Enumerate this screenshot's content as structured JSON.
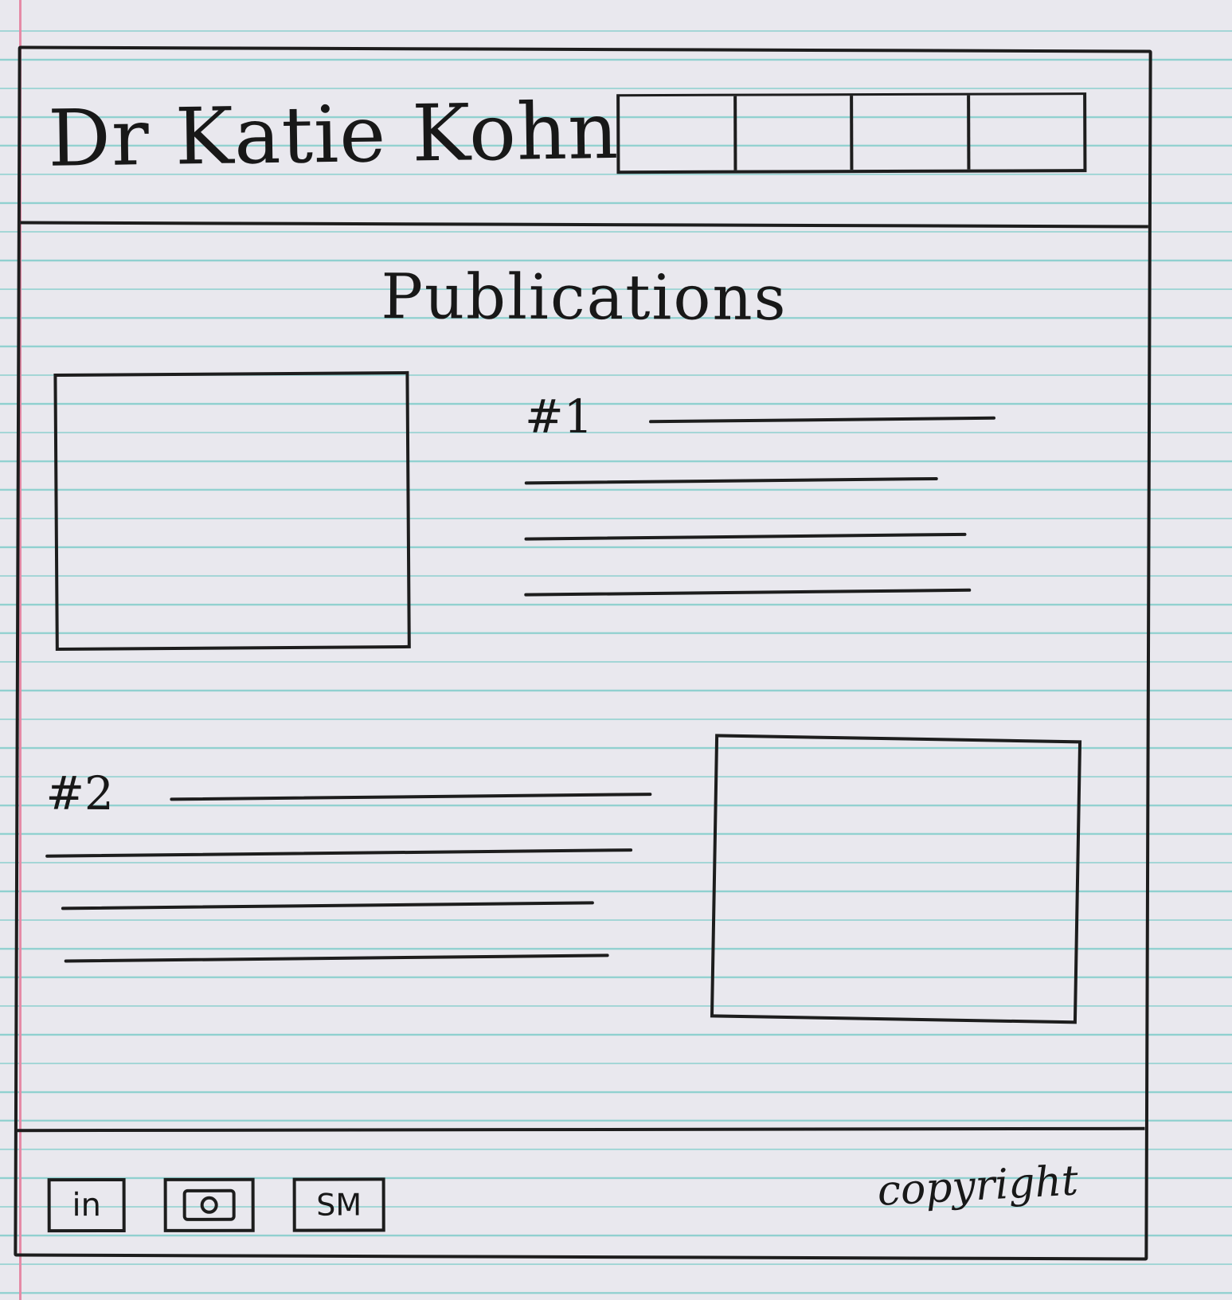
{
  "header": {
    "title": "Dr Katie Kohn",
    "nav_items": [
      {
        "label": ""
      },
      {
        "label": ""
      },
      {
        "label": ""
      },
      {
        "label": ""
      }
    ]
  },
  "main": {
    "title": "Publications",
    "publications": [
      {
        "number": "#1"
      },
      {
        "number": "#2"
      }
    ]
  },
  "footer": {
    "social": [
      {
        "label": "in",
        "icon": "linkedin-icon"
      },
      {
        "label": "",
        "icon": "camera-icon"
      },
      {
        "label": "SM",
        "icon": "social-media-icon"
      }
    ],
    "copyright": "copyright"
  }
}
